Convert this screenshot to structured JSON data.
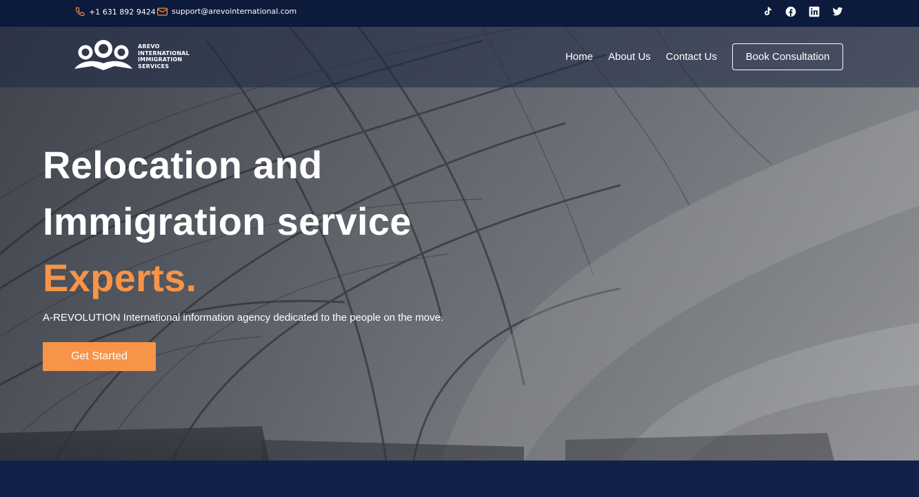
{
  "topbar": {
    "phone": "+1 631 892 9424",
    "email": "support@arevointernational.com",
    "socials": [
      {
        "name": "tiktok-icon"
      },
      {
        "name": "facebook-icon"
      },
      {
        "name": "linkedin-icon"
      },
      {
        "name": "twitter-icon"
      }
    ]
  },
  "brand": {
    "line1": "AREVO",
    "line2": "INTERNATIONAL",
    "line3": "IMMIGRATION",
    "line4": "SERVICES"
  },
  "nav": {
    "home": "Home",
    "about": "About Us",
    "contact": "Contact Us",
    "cta": "Book Consultation"
  },
  "hero": {
    "line1": "Relocation and",
    "line2": "Immigration service",
    "accent": "Experts.",
    "subtext": "A-REVOLUTION International information agency dedicated to the people on the move.",
    "button": "Get Started"
  },
  "colors": {
    "accent": "#f79447",
    "navy": "#0c1a3c",
    "band": "#12214a"
  }
}
